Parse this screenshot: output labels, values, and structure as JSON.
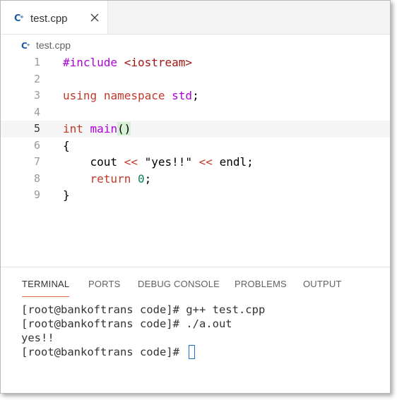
{
  "tab": {
    "label": "test.cpp",
    "icon": "cpp-file-icon",
    "close_icon": "close-icon"
  },
  "breadcrumb": {
    "label": "test.cpp",
    "icon": "cpp-file-icon"
  },
  "editor": {
    "active_line": 5,
    "lines": [
      {
        "n": "1",
        "text": "#include <iostream>"
      },
      {
        "n": "2",
        "text": ""
      },
      {
        "n": "3",
        "text": "using namespace std;"
      },
      {
        "n": "4",
        "text": ""
      },
      {
        "n": "5",
        "text": "int main()"
      },
      {
        "n": "6",
        "text": "{"
      },
      {
        "n": "7",
        "text": "    cout << \"yes!!\" << endl;"
      },
      {
        "n": "8",
        "text": "    return 0;"
      },
      {
        "n": "9",
        "text": "}"
      }
    ]
  },
  "panel": {
    "tabs": [
      "TERMINAL",
      "PORTS",
      "DEBUG CONSOLE",
      "PROBLEMS",
      "OUTPUT"
    ],
    "active_tab": "TERMINAL",
    "terminal_lines": [
      "[root@bankoftrans code]# g++ test.cpp",
      "[root@bankoftrans code]# ./a.out",
      "yes!!",
      "[root@bankoftrans code]# "
    ]
  },
  "colors": {
    "accent_underline": "#e06c4c",
    "cursor": "#1a6fd6",
    "cpp_icon": "#1e5aa8"
  }
}
